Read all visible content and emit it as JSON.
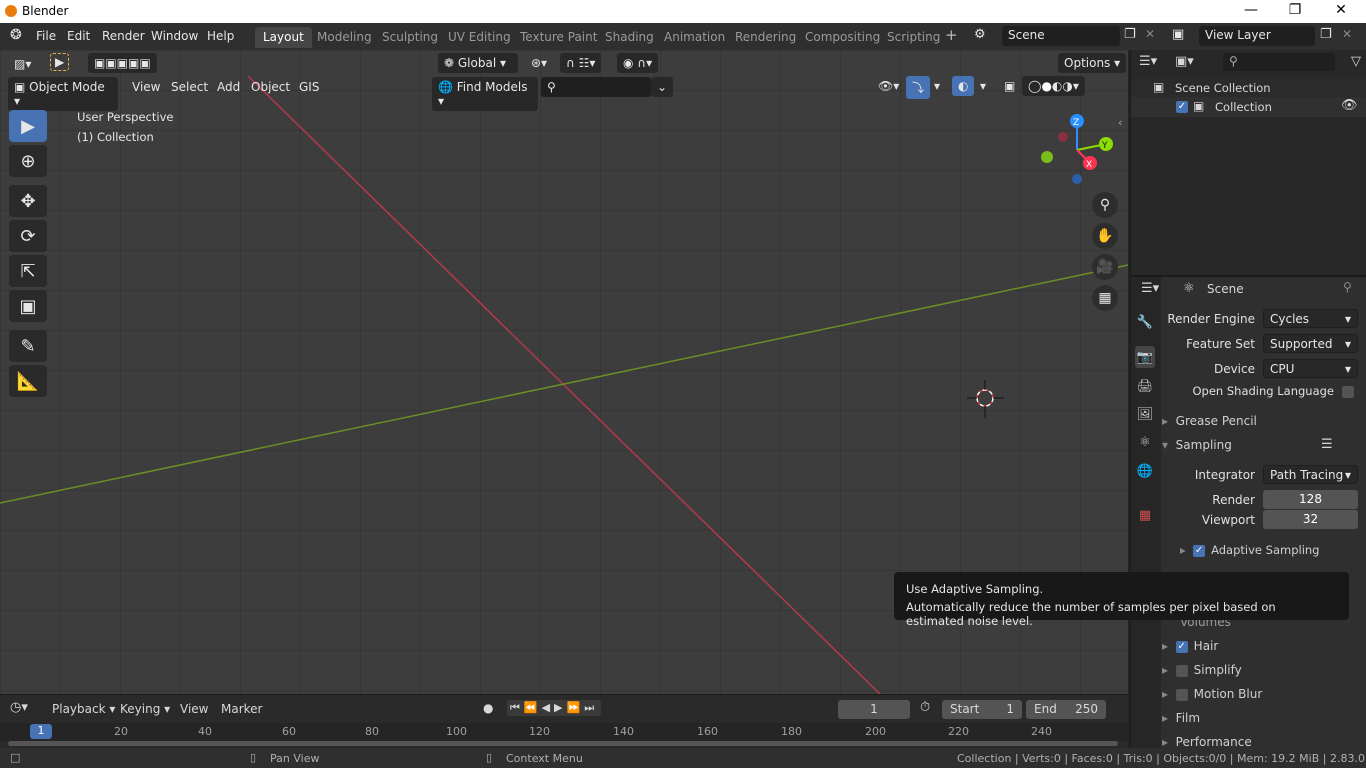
{
  "window": {
    "title": "Blender"
  },
  "menubar": [
    "File",
    "Edit",
    "Render",
    "Window",
    "Help"
  ],
  "workspace_tabs": [
    {
      "label": "Layout",
      "active": true
    },
    {
      "label": "Modeling"
    },
    {
      "label": "Sculpting"
    },
    {
      "label": "UV Editing"
    },
    {
      "label": "Texture Paint"
    },
    {
      "label": "Shading"
    },
    {
      "label": "Animation"
    },
    {
      "label": "Rendering"
    },
    {
      "label": "Compositing"
    },
    {
      "label": "Scripting"
    }
  ],
  "scene_field": "Scene",
  "view_layer_field": "View Layer",
  "viewport": {
    "transform_orientation": "Global",
    "options_label": "Options",
    "mode": "Object Mode",
    "header_menus": [
      "View",
      "Select",
      "Add",
      "Object",
      "GIS"
    ],
    "find_models": "Find Models",
    "overlay_text_line1": "User Perspective",
    "overlay_text_line2": "(1) Collection",
    "gizmo_axes": {
      "z": "Z",
      "y": "Y",
      "x": "X"
    }
  },
  "outliner": {
    "scene_collection": "Scene Collection",
    "collection": "Collection"
  },
  "properties": {
    "header": "Scene",
    "render_engine_label": "Render Engine",
    "render_engine_value": "Cycles",
    "feature_set_label": "Feature Set",
    "feature_set_value": "Supported",
    "device_label": "Device",
    "device_value": "CPU",
    "osl_label": "Open Shading Language",
    "grease_pencil": "Grease Pencil",
    "sampling": "Sampling",
    "integrator_label": "Integrator",
    "integrator_value": "Path Tracing",
    "render_label": "Render",
    "render_value": "128",
    "viewport_label": "Viewport",
    "viewport_value": "32",
    "adaptive_sampling": "Adaptive Sampling",
    "volumes": "Volumes",
    "hair": "Hair",
    "simplify": "Simplify",
    "motion_blur": "Motion Blur",
    "film": "Film",
    "performance": "Performance"
  },
  "tooltip": {
    "line1": "Use Adaptive Sampling.",
    "line2": "Automatically reduce the number of samples per pixel based on estimated noise level."
  },
  "timeline": {
    "menus": [
      "Playback",
      "Keying",
      "View",
      "Marker"
    ],
    "current_frame": "1",
    "start_label": "Start",
    "start_value": "1",
    "end_label": "End",
    "end_value": "250",
    "ruler": [
      "1",
      "20",
      "40",
      "60",
      "80",
      "100",
      "120",
      "140",
      "160",
      "180",
      "200",
      "220",
      "240"
    ]
  },
  "statusbar": {
    "pan_view": "Pan View",
    "context_menu": "Context Menu",
    "stats": "Collection | Verts:0 | Faces:0 | Tris:0 | Objects:0/0 | Mem: 19.2 MiB | 2.83.0"
  },
  "colors": {
    "accent": "#4772b3",
    "x_axis": "#ff3352",
    "y_axis": "#8bdc00",
    "z_axis": "#2890ff"
  }
}
